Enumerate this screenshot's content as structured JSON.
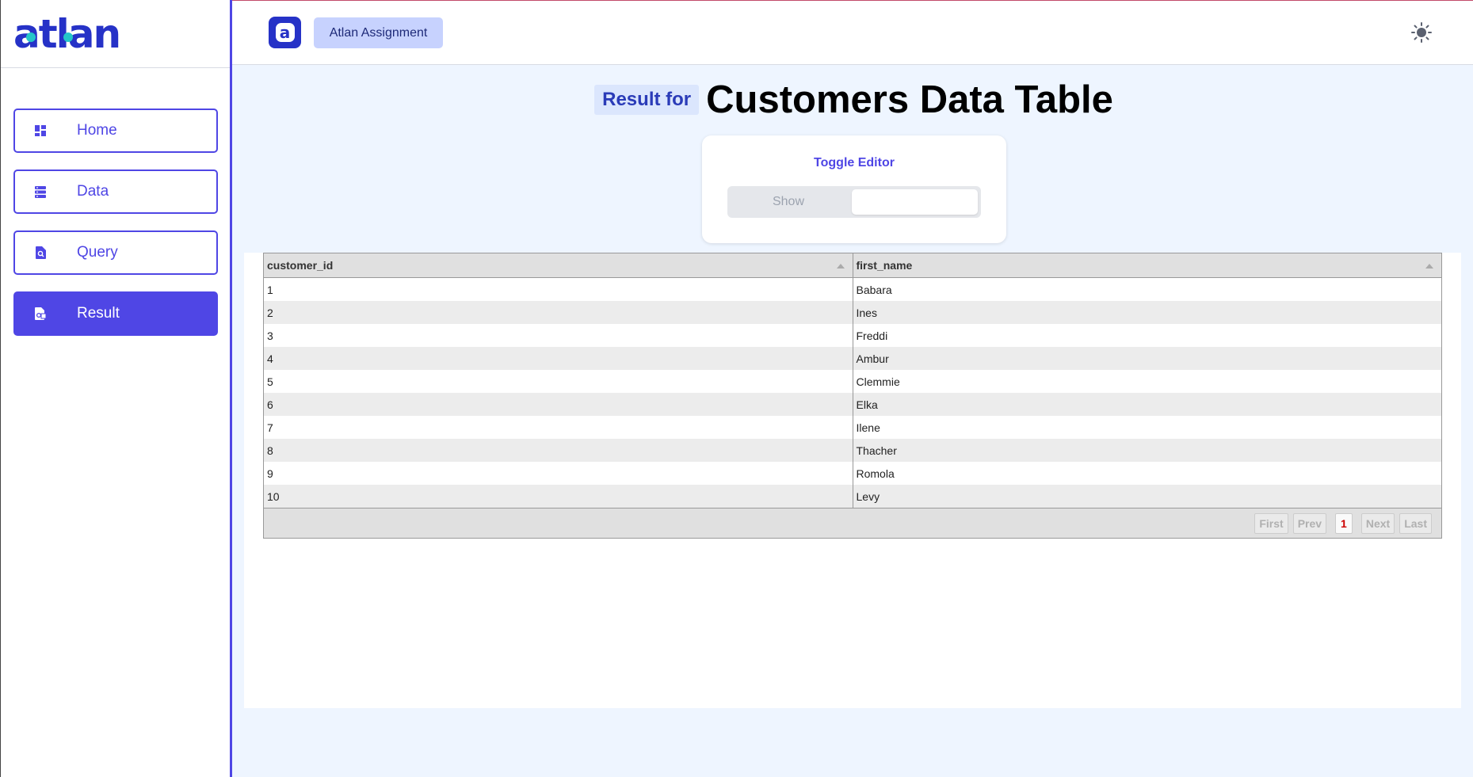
{
  "app": {
    "logo_text": "atlan"
  },
  "sidebar": {
    "items": [
      {
        "label": "Home",
        "icon": "dashboard-icon",
        "active": false
      },
      {
        "label": "Data",
        "icon": "database-icon",
        "active": false
      },
      {
        "label": "Query",
        "icon": "search-file-icon",
        "active": false
      },
      {
        "label": "Result",
        "icon": "result-file-icon",
        "active": true
      }
    ]
  },
  "header": {
    "badge_letter": "a",
    "assignment_label": "Atlan Assignment",
    "theme_icon": "sun-icon"
  },
  "page": {
    "result_for": "Result for",
    "title": "Customers Data Table"
  },
  "toggle": {
    "title": "Toggle Editor",
    "show_label": "Show"
  },
  "table": {
    "columns": [
      "customer_id",
      "first_name"
    ],
    "rows": [
      [
        "1",
        "Babara"
      ],
      [
        "2",
        "Ines"
      ],
      [
        "3",
        "Freddi"
      ],
      [
        "4",
        "Ambur"
      ],
      [
        "5",
        "Clemmie"
      ],
      [
        "6",
        "Elka"
      ],
      [
        "7",
        "Ilene"
      ],
      [
        "8",
        "Thacher"
      ],
      [
        "9",
        "Romola"
      ],
      [
        "10",
        "Levy"
      ]
    ]
  },
  "pagination": {
    "first": "First",
    "prev": "Prev",
    "page": "1",
    "next": "Next",
    "last": "Last"
  },
  "colors": {
    "accent": "#4f46e5",
    "brand": "#2632c7",
    "background": "#eef5ff"
  }
}
